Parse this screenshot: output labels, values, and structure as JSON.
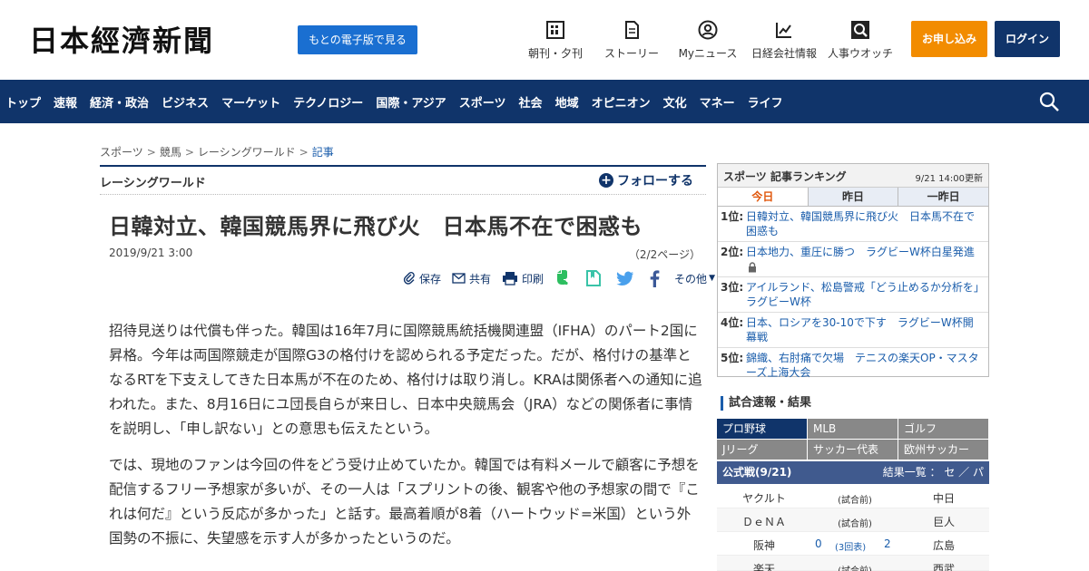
{
  "header": {
    "logo": "日本經濟新聞",
    "paper_button": "もとの電子版で見る",
    "tools": [
      {
        "label": "朝刊・夕刊",
        "icon": "newspaper-icon"
      },
      {
        "label": "ストーリー",
        "icon": "story-icon"
      },
      {
        "label": "Myニュース",
        "icon": "user-icon"
      },
      {
        "label": "日経会社情報",
        "icon": "chart-icon"
      },
      {
        "label": "人事ウオッチ",
        "icon": "search-person-icon"
      }
    ],
    "apply_button": "お申し込み",
    "login_button": "ログイン"
  },
  "nav": {
    "items": [
      "トップ",
      "速報",
      "経済・政治",
      "ビジネス",
      "マーケット",
      "テクノロジー",
      "国際・アジア",
      "スポーツ",
      "社会",
      "地域",
      "オピニオン",
      "文化",
      "マネー",
      "ライフ"
    ]
  },
  "breadcrumb": [
    "スポーツ",
    "競馬",
    "レーシングワールド",
    "記事"
  ],
  "section": {
    "title": "レーシングワールド",
    "follow": "フォローする"
  },
  "article": {
    "headline": "日韓対立、韓国競馬界に飛び火　日本馬不在で困惑も",
    "date": "2019/9/21 3:00",
    "page_info": "（2/2ページ）",
    "share": {
      "save": "保存",
      "share": "共有",
      "print": "印刷",
      "other": "その他"
    },
    "paragraphs": [
      "招待見送りは代償も伴った。韓国は16年7月に国際競馬統括機関連盟（IFHA）のパート2国に昇格。今年は両国際競走が国際G3の格付けを認められる予定だった。だが、格付けの基準となるRTを下支えしてきた日本馬が不在のため、格付けは取り消し。KRAは関係者への通知に追われた。また、8月16日にユ団長自らが来日し、日本中央競馬会（JRA）などの関係者に事情を説明し、「申し訳ない」との意思も伝えたという。",
      "では、現地のファンは今回の件をどう受け止めていたか。韓国では有料メールで顧客に予想を配信するフリー予想家が多いが、その一人は「スプリントの後、観客や他の予想家の間で『これは何だ』という反応が多かった」と話す。最高着順が8着（ハートウッド=米国）という外国勢の不振に、失望感を示す人が多かったというのだ。"
    ]
  },
  "ranking": {
    "title": "スポーツ 記事ランキング",
    "updated": "9/21 14:00更新",
    "tabs": [
      "今日",
      "昨日",
      "一昨日"
    ],
    "items": [
      {
        "rank": "1位:",
        "text": "日韓対立、韓国競馬界に飛び火　日本馬不在で困惑も"
      },
      {
        "rank": "2位:",
        "text": "日本地力、重圧に勝つ　ラグビーW杯白星発進"
      },
      {
        "rank": "3位:",
        "text": "アイルランド、松島警戒「どう止めるか分析を」　ラグビーW杯"
      },
      {
        "rank": "4位:",
        "text": "日本、ロシアを30-10で下す　ラグビーW杯開幕戦"
      },
      {
        "rank": "5位:",
        "text": "錦織、右肘痛で欠場　テニスの楽天OP・マスターズ上海大会"
      }
    ]
  },
  "games": {
    "title": "試合速報・結果",
    "tabs": [
      "プロ野球",
      "MLB",
      "ゴルフ",
      "Jリーグ",
      "サッカー代表",
      "欧州サッカー"
    ],
    "bar_left": "公式戦(9/21)",
    "bar_right": "結果一覧 ： セ ／ パ",
    "rows": [
      {
        "home": "ヤクルト",
        "status": "(試合前)",
        "away": "中日"
      },
      {
        "home": "ＤｅＮＡ",
        "status": "(試合前)",
        "away": "巨人"
      },
      {
        "home": "阪神",
        "score_home": "0",
        "status": "(3回表)",
        "score_away": "2",
        "away": "広島"
      },
      {
        "home": "楽天",
        "status": "(試合前)",
        "away": "西武"
      }
    ]
  }
}
